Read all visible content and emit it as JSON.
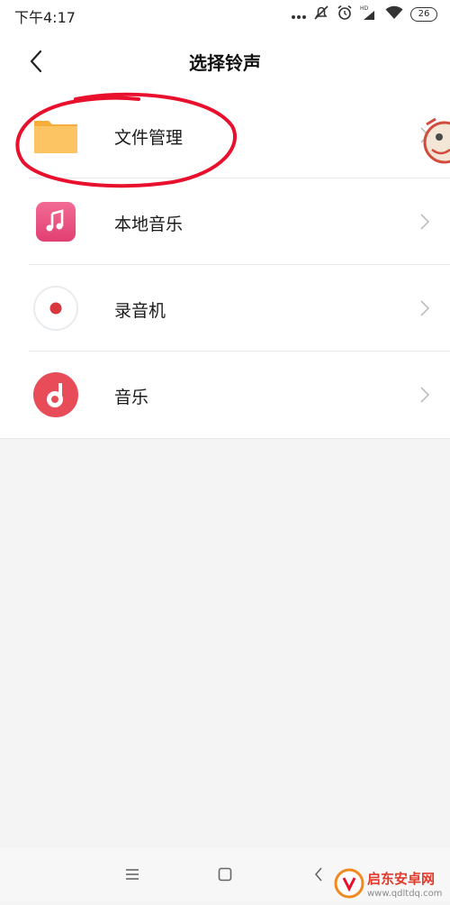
{
  "status_bar": {
    "time": "下午4:17",
    "network_label": "HD",
    "battery_level": "26"
  },
  "header": {
    "title": "选择铃声"
  },
  "ringtone_sources": [
    {
      "label": "文件管理",
      "icon": "folder-icon",
      "color": "#f9bf5a"
    },
    {
      "label": "本地音乐",
      "icon": "music-note-icon",
      "color": "#e9457a"
    },
    {
      "label": "录音机",
      "icon": "recorder-icon",
      "color": "#d9363e"
    },
    {
      "label": "音乐",
      "icon": "music-app-icon",
      "color": "#e94c59"
    }
  ],
  "watermark": {
    "name": "启东安卓网",
    "url": "www.qdltdq.com"
  },
  "colors": {
    "annotation": "#e8102c",
    "page_background": "#f4f4f4",
    "list_background": "#ffffff"
  }
}
